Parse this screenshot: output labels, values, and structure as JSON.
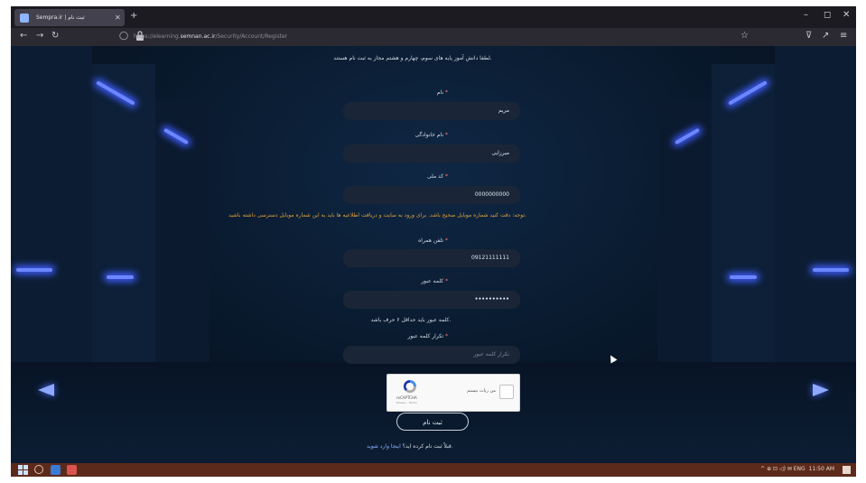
{
  "browser": {
    "tab_title": "Sempra.ir | ثبت نام",
    "new_tab": "+",
    "url_prefix": "https://elearning.",
    "url_domain": "semnan.ac.ir",
    "url_path": "/Security/Account/Register",
    "controls": {
      "minimize": "–",
      "maximize": "◻",
      "close": "✕"
    }
  },
  "page": {
    "intro": "لطفا دانش آموز پایه های سوم، چهارم و هشتم مجاز به ثبت نام هستند.",
    "first_name": {
      "label": "نام",
      "value": "مریم"
    },
    "last_name": {
      "label": "نام خانوادگی",
      "value": "میرزایی"
    },
    "national_code": {
      "label": "کد ملی",
      "value": "0000000000"
    },
    "warning": "توجه: دقت کنید شماره موبایل صحیح باشد. برای ورود به سایت و دریافت اطلاعیه ها باید به این شماره موبایل دسترسی داشته باشید.",
    "mobile": {
      "label": "تلفن همراه",
      "value": "09121111111"
    },
    "password": {
      "label": "کلمه عبور",
      "value": "••••••••••"
    },
    "password_hint": "کلمه عبور باید حداقل ۶ حرف باشد.",
    "confirm_password": {
      "label": "تکرار کلمه عبور",
      "placeholder": "تکرار کلمه عبور"
    },
    "captcha": {
      "checkbox_label": "من ربات نیستم",
      "brand": "reCAPTCHA",
      "terms": "Privacy - Terms"
    },
    "submit_label": "ثبت نام",
    "footer_text": "قبلاً ثبت نام کرده اید؟",
    "footer_link": "اینجا وارد شوید."
  },
  "taskbar": {
    "tray_text": "^  ⊕  ⊡  ◁)  ✉  ENG",
    "time": "11:50 AM"
  },
  "colors": {
    "background": "#0b1628",
    "neon": "#6c86ff",
    "warning": "#e3a23a",
    "field": "#1a2638",
    "taskbar": "#5c2a1a"
  }
}
